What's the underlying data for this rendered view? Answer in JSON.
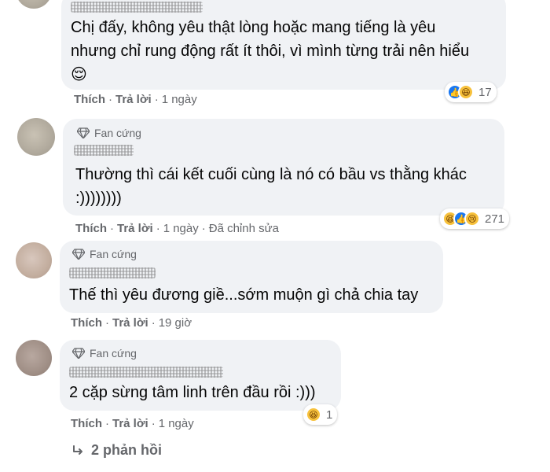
{
  "comments": [
    {
      "text": "Chị đấy, không yêu thật lòng hoặc mang tiếng là yêu nhưng chỉ rung động rất ít thôi, vì mình từng trải nên hiểu 😌",
      "like_label": "Thích",
      "reply_label": "Trả lời",
      "sep": "·",
      "time": "1 ngày",
      "reactions": [
        "like",
        "haha"
      ],
      "reaction_count": "17"
    },
    {
      "badge": "Fan cứng",
      "text": "Thường thì cái kết cuối cùng là nó có bầu vs thằng khác :))))))))",
      "like_label": "Thích",
      "reply_label": "Trả lời",
      "sep": "·",
      "time": "1 ngày",
      "edited": "Đã chỉnh sửa",
      "reactions": [
        "haha",
        "like",
        "sad"
      ],
      "reaction_count": "271"
    },
    {
      "badge": "Fan cứng",
      "text": "Thế thì yêu đương giề...sớm muộn gì chả chia tay",
      "like_label": "Thích",
      "reply_label": "Trả lời",
      "sep": "·",
      "time": "19 giờ"
    },
    {
      "badge": "Fan cứng",
      "text": "2 cặp sừng tâm linh trên đầu rồi :)))",
      "like_label": "Thích",
      "reply_label": "Trả lời",
      "sep": "·",
      "time": "1 ngày",
      "reactions": [
        "haha"
      ],
      "reaction_count": "1"
    }
  ],
  "replies_label": "2 phản hồi",
  "colors": {
    "bubble": "#f0f2f5",
    "meta_text": "#65676b",
    "like_blue": "#1877f2",
    "emoji_yellow": "#f7c13c"
  }
}
